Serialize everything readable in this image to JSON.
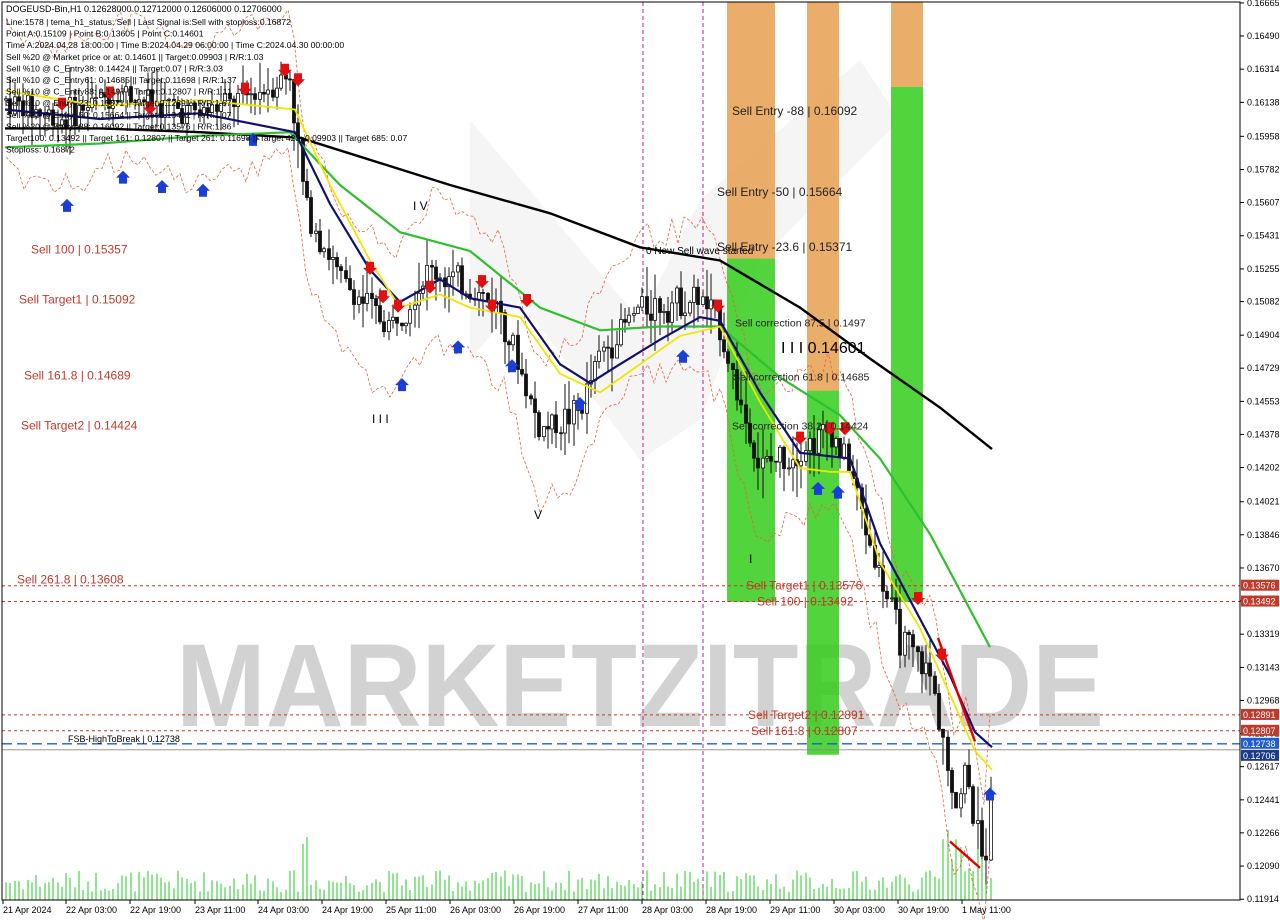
{
  "chart_data": {
    "type": "candlestick",
    "symbol_line": "DOGEUSD-Bin,H1  0.12628000 0.12712000 0.12606000 0.12706000",
    "info_lines": [
      "Line:1578 | tema_h1_status: Sell | Last Signal is:Sell with stoploss:0.16872",
      "Point A:0.15109 | Point B:0.13605 | Point C:0.14601",
      "Time A:2024.04.28 18:00:00 | Time B:2024.04.29 06:00:00 | Time C:2024.04.30 00:00:00",
      "Sell %20 @ Market price or at: 0.14601 || Target:0.09903 | R/R:1.03",
      "Sell %10 @ C_Entry38: 0.14424 || Target:0.07 | R/R:3.03",
      "Sell %10 @ C_Entry61: 0.14685 || Target:0.11698 | R/R:1.37",
      "Sell %10 @ C_Entry88: 0.1497 || Target:0.12807 | R/R:1.11",
      "Sell %10 @ Entry -23: 0.15371 || Target:0.12891 | R/R:1.67",
      "Sell %20 @ Entry -50: 0.15664 || Target:0.13492 | R/R:1.07",
      "Sell %20 @ Entry -88: 0.16092 || Target:0.13576 | R/R:1.86",
      "Target100: 0.13492 || Target 161: 0.12807 || Target 261: 0.11698 || Target 423: 0.09903 || Target 685: 0.07",
      "Stoploss: 0.16872"
    ],
    "y_ticks": [
      "0.16665",
      "0.16490",
      "0.16314",
      "0.16138",
      "0.15958",
      "0.15782",
      "0.15607",
      "0.15431",
      "0.15255",
      "0.15082",
      "0.14904",
      "0.14729",
      "0.14553",
      "0.14378",
      "0.14202",
      "0.14021",
      "0.13846",
      "0.13670",
      "0.13495",
      "0.13319",
      "0.13143",
      "0.12968",
      "0.12792",
      "0.12617",
      "0.12441",
      "0.12266",
      "0.12090",
      "0.11914"
    ],
    "ylim": [
      0.1191,
      0.1667
    ],
    "x_ticks": [
      "21 Apr 2024",
      "22 Apr 03:00",
      "22 Apr 19:00",
      "23 Apr 11:00",
      "24 Apr 03:00",
      "24 Apr 19:00",
      "25 Apr 11:00",
      "26 Apr 03:00",
      "26 Apr 19:00",
      "27 Apr 11:00",
      "28 Apr 03:00",
      "28 Apr 19:00",
      "29 Apr 11:00",
      "30 Apr 03:00",
      "30 Apr 19:00",
      "1 May 11:00"
    ],
    "price_tags": [
      {
        "text": "0.13576",
        "price": 0.13576,
        "color": "#c0392b"
      },
      {
        "text": "0.13492",
        "price": 0.13492,
        "color": "#c0392b"
      },
      {
        "text": "0.12891",
        "price": 0.12891,
        "color": "#c0392b"
      },
      {
        "text": "0.12807",
        "price": 0.12807,
        "color": "#c0392b"
      },
      {
        "text": "0.12738",
        "price": 0.12738,
        "color": "#1e5bd6"
      },
      {
        "text": "0.12706",
        "price": 0.12706,
        "color": "#1e3a8a"
      }
    ],
    "left_levels": [
      {
        "text": "Sell 100 | 0.15357",
        "price": 0.15357
      },
      {
        "text": "Sell Target1 | 0.15092",
        "price": 0.15092
      },
      {
        "text": "Sell 161.8 | 0.14689",
        "price": 0.14689
      },
      {
        "text": "Sell Target2 | 0.14424",
        "price": 0.14424
      },
      {
        "text": "Sell 261.8 | 0.13608",
        "price": 0.13608
      }
    ],
    "right_levels": [
      {
        "text": "Sell Entry -88 | 0.16092",
        "price": 0.16092
      },
      {
        "text": "Sell Entry -50 | 0.15664",
        "price": 0.15664
      },
      {
        "text": "Sell Entry -23.6 | 0.15371",
        "price": 0.15371
      },
      {
        "text": "Sell correction 87.5 | 0.1497",
        "price": 0.1497
      },
      {
        "text": "Sell correction 61.8 | 0.14685",
        "price": 0.14685
      },
      {
        "text": "Sell correction 38.2 | 0.14424",
        "price": 0.14424
      },
      {
        "text": "Sell Target1 | 0.13576",
        "price": 0.13576
      },
      {
        "text": "Sell 100 | 0.13492",
        "price": 0.13492
      },
      {
        "text": "Sell Target2 | 0.12891",
        "price": 0.12891
      },
      {
        "text": "Sell 161.8 | 0.12807",
        "price": 0.12807
      }
    ],
    "wave_labels": [
      "I V",
      "I I I",
      "V",
      "I",
      "I I I 0.14601",
      "0 New Sell wave started"
    ],
    "fsb_label": "FSB-HighToBreak  | 0.12738",
    "watermark": "MARKETZITRADE",
    "colors": {
      "bull": "#111111",
      "bear": "#111111",
      "ma_black": "#000000",
      "ma_green": "#2fbf2f",
      "ma_navy": "#101070",
      "ma_yellow": "#f2e500",
      "orange_dash": "#e8623a",
      "level_red": "#c0392b",
      "fsb_blue": "#1e5bd6",
      "zone_orange": "#e8a050",
      "zone_green": "#33cc1a",
      "volume": "#22cc22",
      "session_magenta": "#c0208c"
    }
  }
}
